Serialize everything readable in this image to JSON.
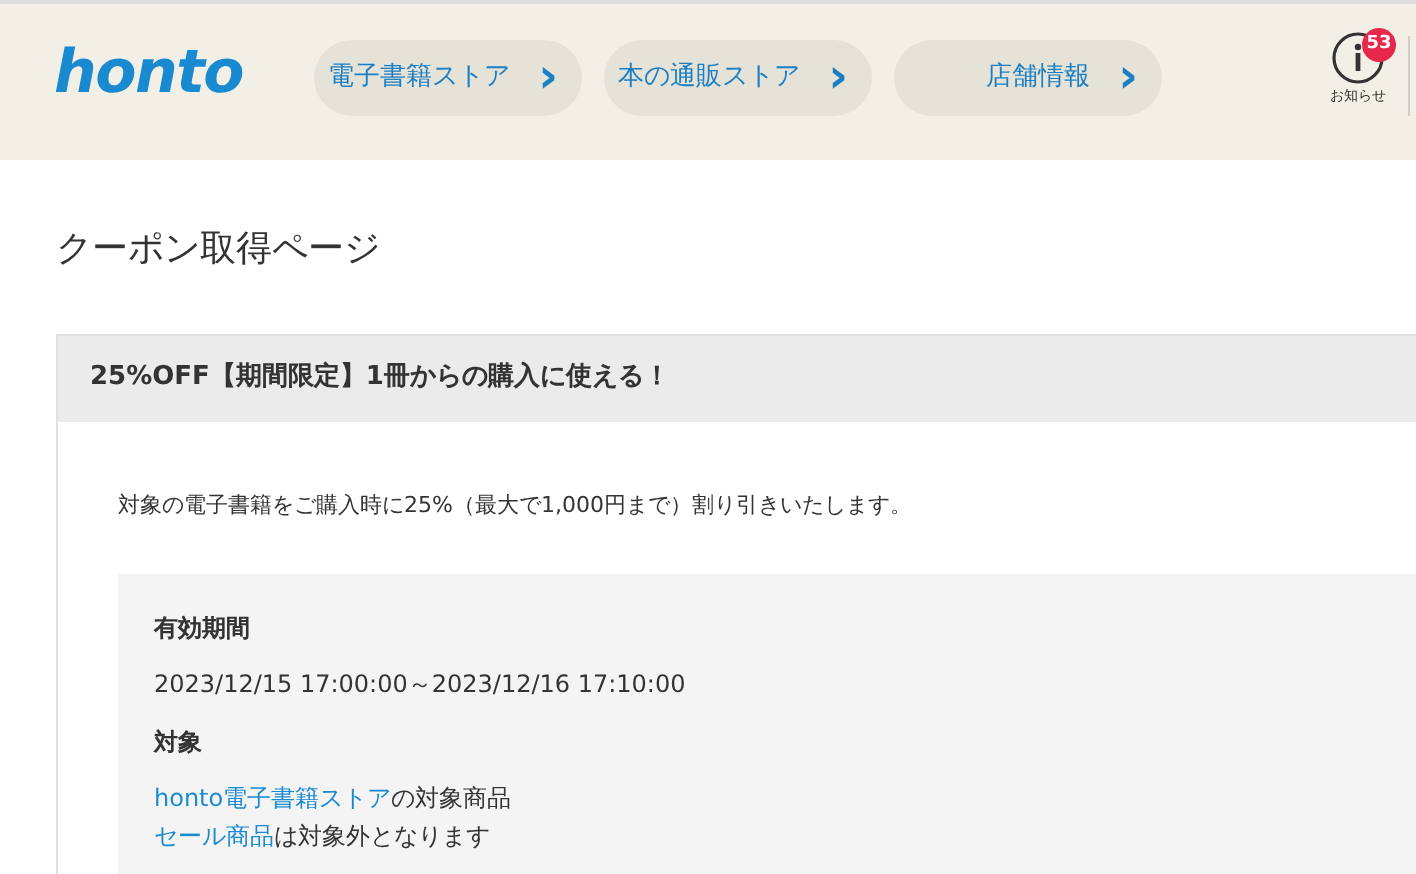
{
  "header": {
    "logo": "honto",
    "nav": [
      {
        "label": "電子書籍ストア",
        "icon": "›"
      },
      {
        "label": "本の通販ストア",
        "icon": "›"
      },
      {
        "label": "店舗情報",
        "icon": "›"
      }
    ],
    "notice": {
      "label": "お知らせ",
      "badge": "53"
    }
  },
  "page_title": "クーポン取得ページ",
  "coupon": {
    "title": "25%OFF【期間限定】1冊からの購入に使える！",
    "description": "対象の電子書籍をご購入時に25%（最大で1,000円まで）割り引きいたします。",
    "details": [
      {
        "heading": "有効期間",
        "lines": [
          {
            "text": "2023/12/15 17:00:00～2023/12/16 17:10:00"
          }
        ]
      },
      {
        "heading": "対象",
        "lines": [
          {
            "link": "honto電子書籍ストア",
            "text": "の対象商品"
          },
          {
            "link": "セール商品",
            "text": "は対象外となります"
          }
        ]
      }
    ]
  }
}
